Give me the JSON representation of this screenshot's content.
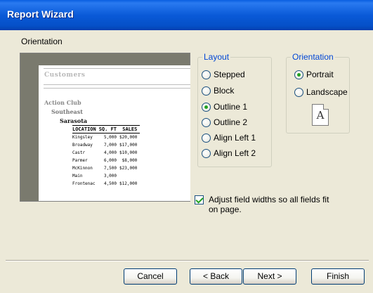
{
  "window": {
    "title": "Report Wizard"
  },
  "section_title": "Orientation",
  "preview": {
    "report_title": "Customers",
    "group_levels": [
      "Action Club",
      "Southeast",
      "Sarasota"
    ],
    "columns": [
      "LOCATION",
      "SQ. FT",
      "SALES"
    ],
    "rows": [
      [
        "Kingsley",
        "5,000",
        "$20,000"
      ],
      [
        "Broadway",
        "7,000",
        "$17,000"
      ],
      [
        "Castr",
        "4,000",
        "$10,000"
      ],
      [
        "Parmer",
        "6,000",
        "$8,000"
      ],
      [
        "McKinnon",
        "7,500",
        "$23,000"
      ],
      [
        "Main",
        "3,000",
        ""
      ],
      [
        "Frontenac",
        "4,500",
        "$12,000"
      ]
    ]
  },
  "layout": {
    "legend": "Layout",
    "options": [
      {
        "label": "Stepped",
        "selected": false
      },
      {
        "label": "Block",
        "selected": false
      },
      {
        "label": "Outline 1",
        "selected": true
      },
      {
        "label": "Outline 2",
        "selected": false
      },
      {
        "label": "Align Left 1",
        "selected": false
      },
      {
        "label": "Align Left 2",
        "selected": false
      }
    ]
  },
  "orientation": {
    "legend": "Orientation",
    "options": [
      {
        "label": "Portrait",
        "selected": true
      },
      {
        "label": "Landscape",
        "selected": false
      }
    ],
    "page_icon_letter": "A"
  },
  "adjust_widths": {
    "label": "Adjust field widths so all fields fit on page.",
    "checked": true
  },
  "buttons": {
    "cancel": "Cancel",
    "back": "< Back",
    "next": "Next >",
    "finish": "Finish"
  },
  "colors": {
    "title_bar": "#0a5ad8",
    "window_bg": "#ece9d8",
    "group_legend": "#0046d5",
    "selected_indicator": "#21a121"
  }
}
